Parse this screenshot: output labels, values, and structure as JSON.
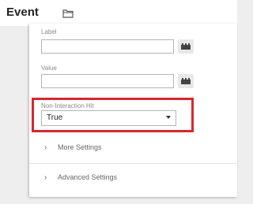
{
  "header": {
    "title": "Event"
  },
  "fields": {
    "label": {
      "label": "Label",
      "value": ""
    },
    "value": {
      "label": "Value",
      "value": ""
    },
    "non_interaction": {
      "label": "Non-Interaction Hit",
      "selected": "True"
    }
  },
  "sections": {
    "more_settings": "More Settings",
    "advanced_settings": "Advanced Settings"
  },
  "icons": {
    "folder": "folder-icon",
    "variable": "variable-picker-icon",
    "chevron": "chevron-right-icon",
    "caret": "caret-down-icon"
  },
  "colors": {
    "highlight": "#d9272e"
  }
}
